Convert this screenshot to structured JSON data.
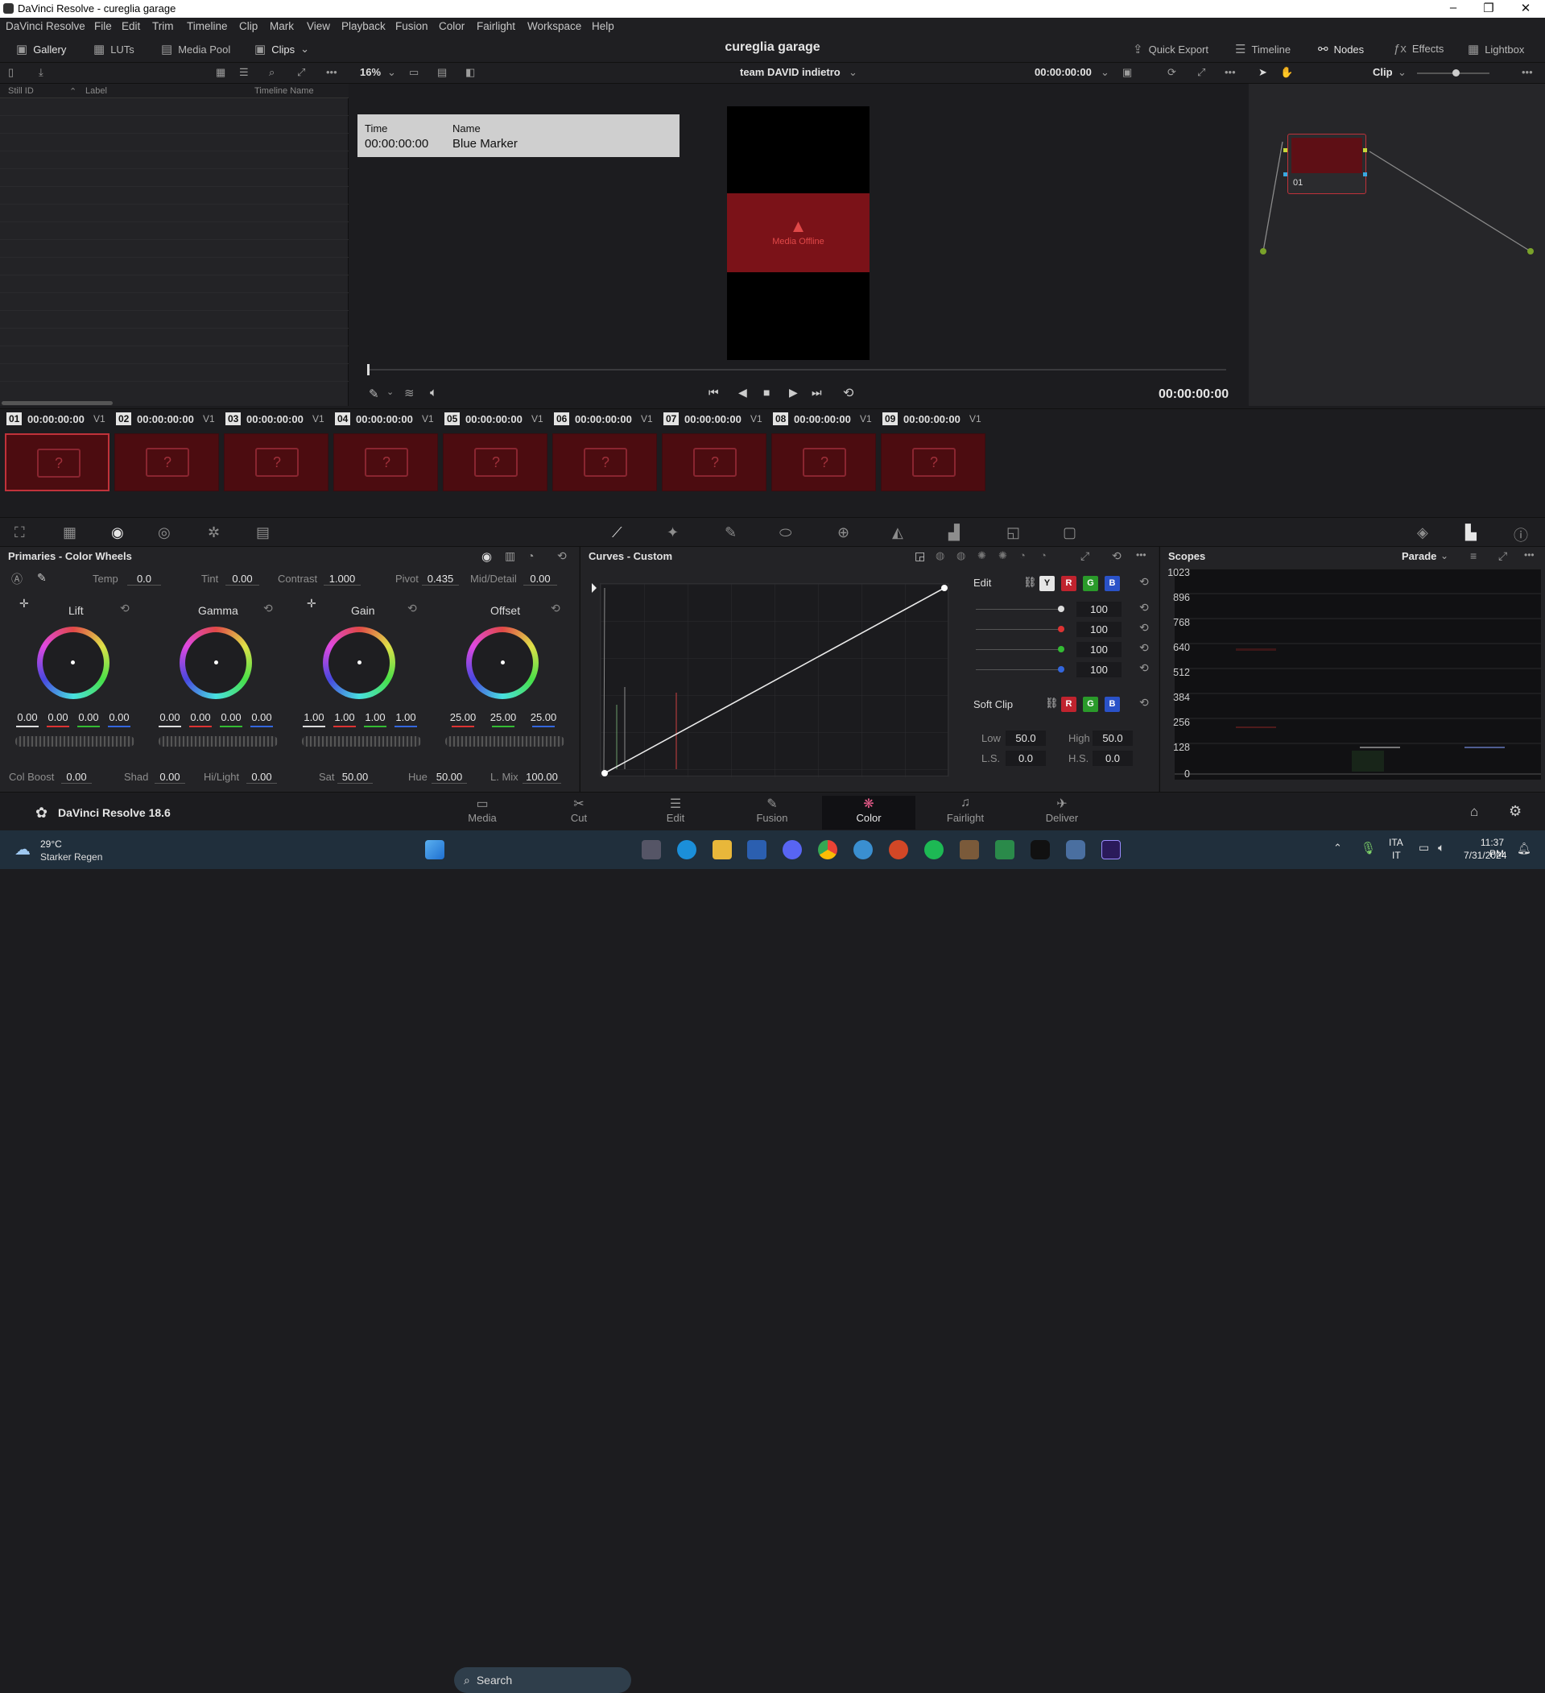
{
  "window": {
    "title": "DaVinci Resolve - cureglia garage",
    "minimize": "–",
    "maximize": "❐",
    "close": "✕"
  },
  "menu": [
    "DaVinci Resolve",
    "File",
    "Edit",
    "Trim",
    "Timeline",
    "Clip",
    "Mark",
    "View",
    "Playback",
    "Fusion",
    "Color",
    "Fairlight",
    "Workspace",
    "Help"
  ],
  "toolbar": {
    "gallery": "Gallery",
    "luts": "LUTs",
    "media_pool": "Media Pool",
    "clips": "Clips",
    "project_title": "cureglia garage",
    "quick_export": "Quick Export",
    "timeline": "Timeline",
    "nodes": "Nodes",
    "effects": "Effects",
    "lightbox": "Lightbox"
  },
  "viewer_bar": {
    "zoom": "16%",
    "timeline_name": "team DAVID indietro",
    "timecode": "00:00:00:00",
    "node_mode": "Clip"
  },
  "gallery": {
    "columns": [
      "Still ID",
      "Label",
      "Timeline Name"
    ]
  },
  "marker": {
    "time_label": "Time",
    "time_value": "00:00:00:00",
    "name_label": "Name",
    "name_value": "Blue Marker"
  },
  "viewer": {
    "offline_text": "Media Offline",
    "timecode": "00:00:00:00"
  },
  "node": {
    "label": "01"
  },
  "clips": [
    {
      "num": "01",
      "tc": "00:00:00:00",
      "track": "V1"
    },
    {
      "num": "02",
      "tc": "00:00:00:00",
      "track": "V1"
    },
    {
      "num": "03",
      "tc": "00:00:00:00",
      "track": "V1"
    },
    {
      "num": "04",
      "tc": "00:00:00:00",
      "track": "V1"
    },
    {
      "num": "05",
      "tc": "00:00:00:00",
      "track": "V1"
    },
    {
      "num": "06",
      "tc": "00:00:00:00",
      "track": "V1"
    },
    {
      "num": "07",
      "tc": "00:00:00:00",
      "track": "V1"
    },
    {
      "num": "08",
      "tc": "00:00:00:00",
      "track": "V1"
    },
    {
      "num": "09",
      "tc": "00:00:00:00",
      "track": "V1"
    }
  ],
  "primaries": {
    "title": "Primaries - Color Wheels",
    "temp_label": "Temp",
    "temp": "0.0",
    "tint_label": "Tint",
    "tint": "0.00",
    "contrast_label": "Contrast",
    "contrast": "1.000",
    "pivot_label": "Pivot",
    "pivot": "0.435",
    "middetail_label": "Mid/Detail",
    "middetail": "0.00",
    "wheels": [
      {
        "name": "Lift",
        "values": [
          "0.00",
          "0.00",
          "0.00",
          "0.00"
        ]
      },
      {
        "name": "Gamma",
        "values": [
          "0.00",
          "0.00",
          "0.00",
          "0.00"
        ]
      },
      {
        "name": "Gain",
        "values": [
          "1.00",
          "1.00",
          "1.00",
          "1.00"
        ]
      },
      {
        "name": "Offset",
        "values": [
          "25.00",
          "25.00",
          "25.00"
        ]
      }
    ],
    "colboost_label": "Col Boost",
    "colboost": "0.00",
    "shad_label": "Shad",
    "shad": "0.00",
    "hilight_label": "Hi/Light",
    "hilight": "0.00",
    "sat_label": "Sat",
    "sat": "50.00",
    "hue_label": "Hue",
    "hue": "50.00",
    "lmix_label": "L. Mix",
    "lmix": "100.00"
  },
  "curves": {
    "title": "Curves - Custom",
    "edit_label": "Edit",
    "channels": [
      "Y",
      "R",
      "G",
      "B"
    ],
    "intensity": [
      "100",
      "100",
      "100",
      "100"
    ],
    "softclip_label": "Soft Clip",
    "low_label": "Low",
    "low": "50.0",
    "high_label": "High",
    "high": "50.0",
    "ls_label": "L.S.",
    "ls": "0.0",
    "hs_label": "H.S.",
    "hs": "0.0"
  },
  "scopes": {
    "title": "Scopes",
    "mode": "Parade",
    "yaxis": [
      "1023",
      "896",
      "768",
      "640",
      "512",
      "384",
      "256",
      "128",
      "0"
    ]
  },
  "pages": [
    {
      "label": "Media",
      "icon": "▭"
    },
    {
      "label": "Cut",
      "icon": "✂"
    },
    {
      "label": "Edit",
      "icon": "☰"
    },
    {
      "label": "Fusion",
      "icon": "✎"
    },
    {
      "label": "Color",
      "icon": "❋"
    },
    {
      "label": "Fairlight",
      "icon": "♫"
    },
    {
      "label": "Deliver",
      "icon": "✈"
    }
  ],
  "app_version": "DaVinci Resolve 18.6",
  "taskbar": {
    "weather_temp": "29°C",
    "weather_desc": "Starker Regen",
    "search_placeholder": "Search",
    "lang": "ITA",
    "lang2": "IT",
    "time": "11:37 PM",
    "date": "7/31/2024"
  },
  "colors": {
    "accent_red": "#c0323a",
    "offline_bg": "#7b1218",
    "active_tab": "#111114"
  }
}
